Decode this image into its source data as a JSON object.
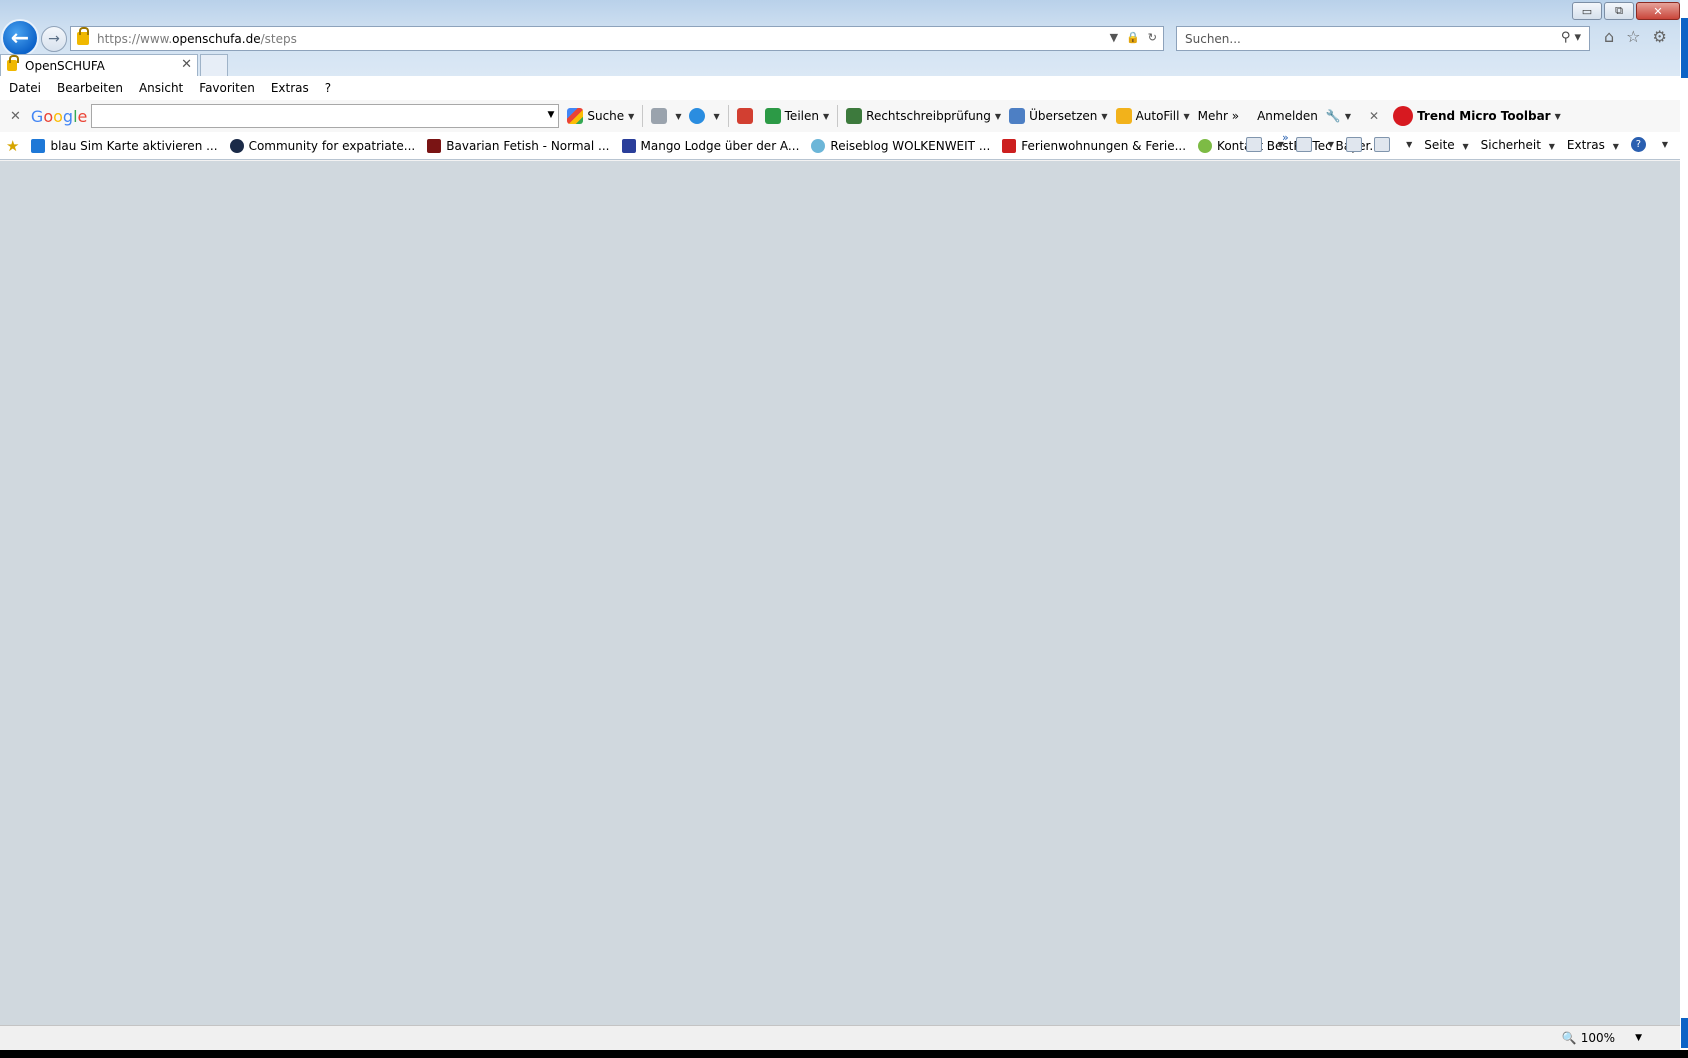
{
  "window": {
    "controls": {
      "minimize": "▭",
      "restore": "⧉",
      "close": "✕"
    }
  },
  "address": {
    "url_prefix": "https://www.",
    "url_domain": "openschufa.de",
    "url_path": "/steps"
  },
  "search": {
    "placeholder": "Suchen..."
  },
  "tab": {
    "title": "OpenSCHUFA"
  },
  "menu": {
    "items": [
      "Datei",
      "Bearbeiten",
      "Ansicht",
      "Favoriten",
      "Extras",
      "?"
    ]
  },
  "google_toolbar": {
    "logo": [
      "G",
      "o",
      "o",
      "g",
      "l",
      "e"
    ],
    "search_label": "Suche",
    "share_label": "Teilen",
    "spellcheck_label": "Rechtschreibprüfung",
    "translate_label": "Übersetzen",
    "autofill_label": "AutoFill",
    "more_label": "Mehr »",
    "signin_label": "Anmelden",
    "trend_label": "Trend Micro Toolbar"
  },
  "favorites": {
    "items": [
      {
        "label": "blau Sim Karte aktivieren ...",
        "color": "#1e78d7"
      },
      {
        "label": "Community for expatriate...",
        "color": "#1b2b48"
      },
      {
        "label": "Bavarian Fetish - Normal ...",
        "color": "#7a1414"
      },
      {
        "label": "Mango Lodge über der A...",
        "color": "#2a3e9a"
      },
      {
        "label": "Reiseblog WOLKENWEIT  ...",
        "color": "#6cb6d8"
      },
      {
        "label": "Ferienwohnungen & Ferie...",
        "color": "#cc1f1f"
      },
      {
        "label": "Kontakt  BestProTec Bayer...",
        "color": "#7dbb45"
      }
    ],
    "page_label": "Seite",
    "security_label": "Sicherheit",
    "tools_label": "Extras"
  },
  "status": {
    "zoom": "100%"
  }
}
